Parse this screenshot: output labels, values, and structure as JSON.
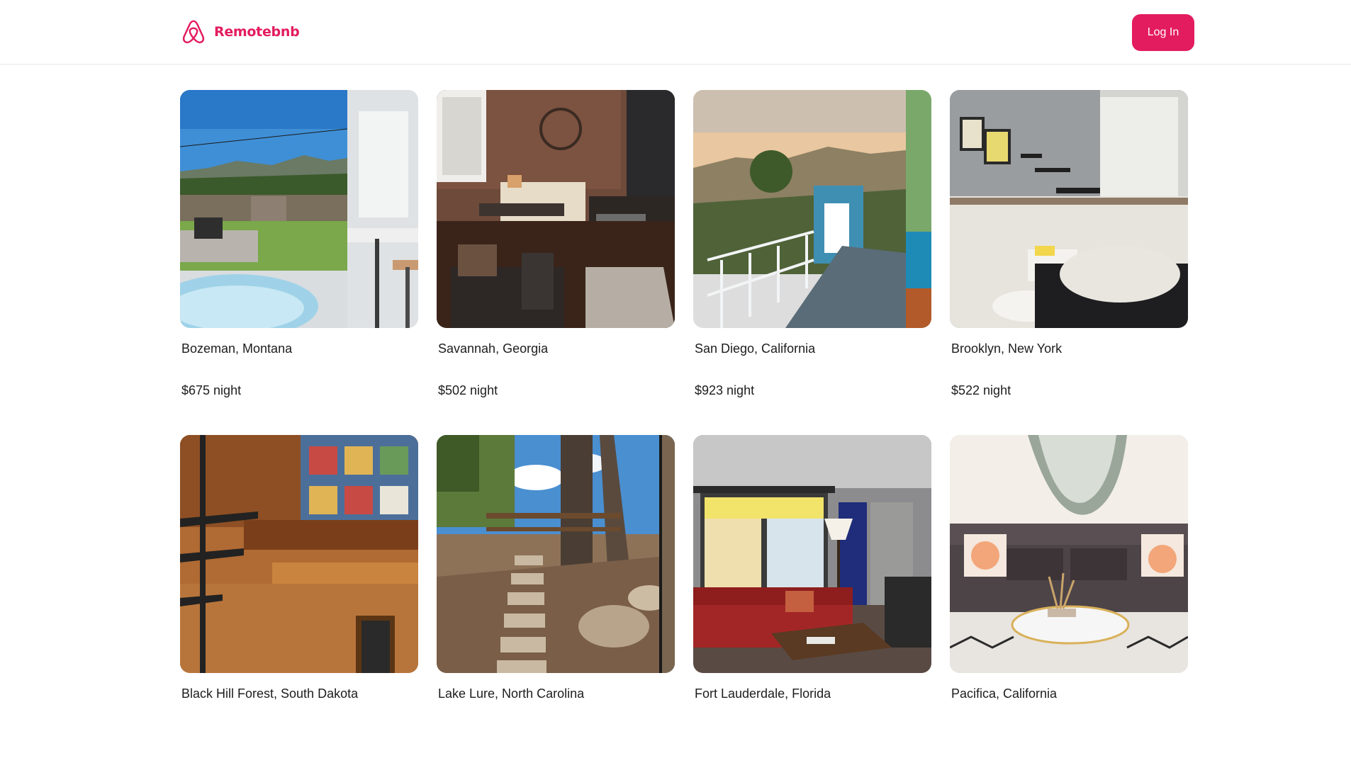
{
  "header": {
    "brand_icon": "airbnb-logo-icon",
    "brand_name": "Remotebnb",
    "login_label": "Log In",
    "accent_color": "#e31c5f"
  },
  "listings": [
    {
      "location": "Bozeman, Montana",
      "price": "$675 night"
    },
    {
      "location": "Savannah, Georgia",
      "price": "$502 night"
    },
    {
      "location": "San Diego, California",
      "price": "$923 night"
    },
    {
      "location": "Brooklyn, New York",
      "price": "$522 night"
    },
    {
      "location": "Black Hill Forest, South Dakota",
      "price": ""
    },
    {
      "location": "Lake Lure, North Carolina",
      "price": ""
    },
    {
      "location": "Fort Lauderdale, Florida",
      "price": ""
    },
    {
      "location": "Pacifica, California",
      "price": ""
    }
  ]
}
